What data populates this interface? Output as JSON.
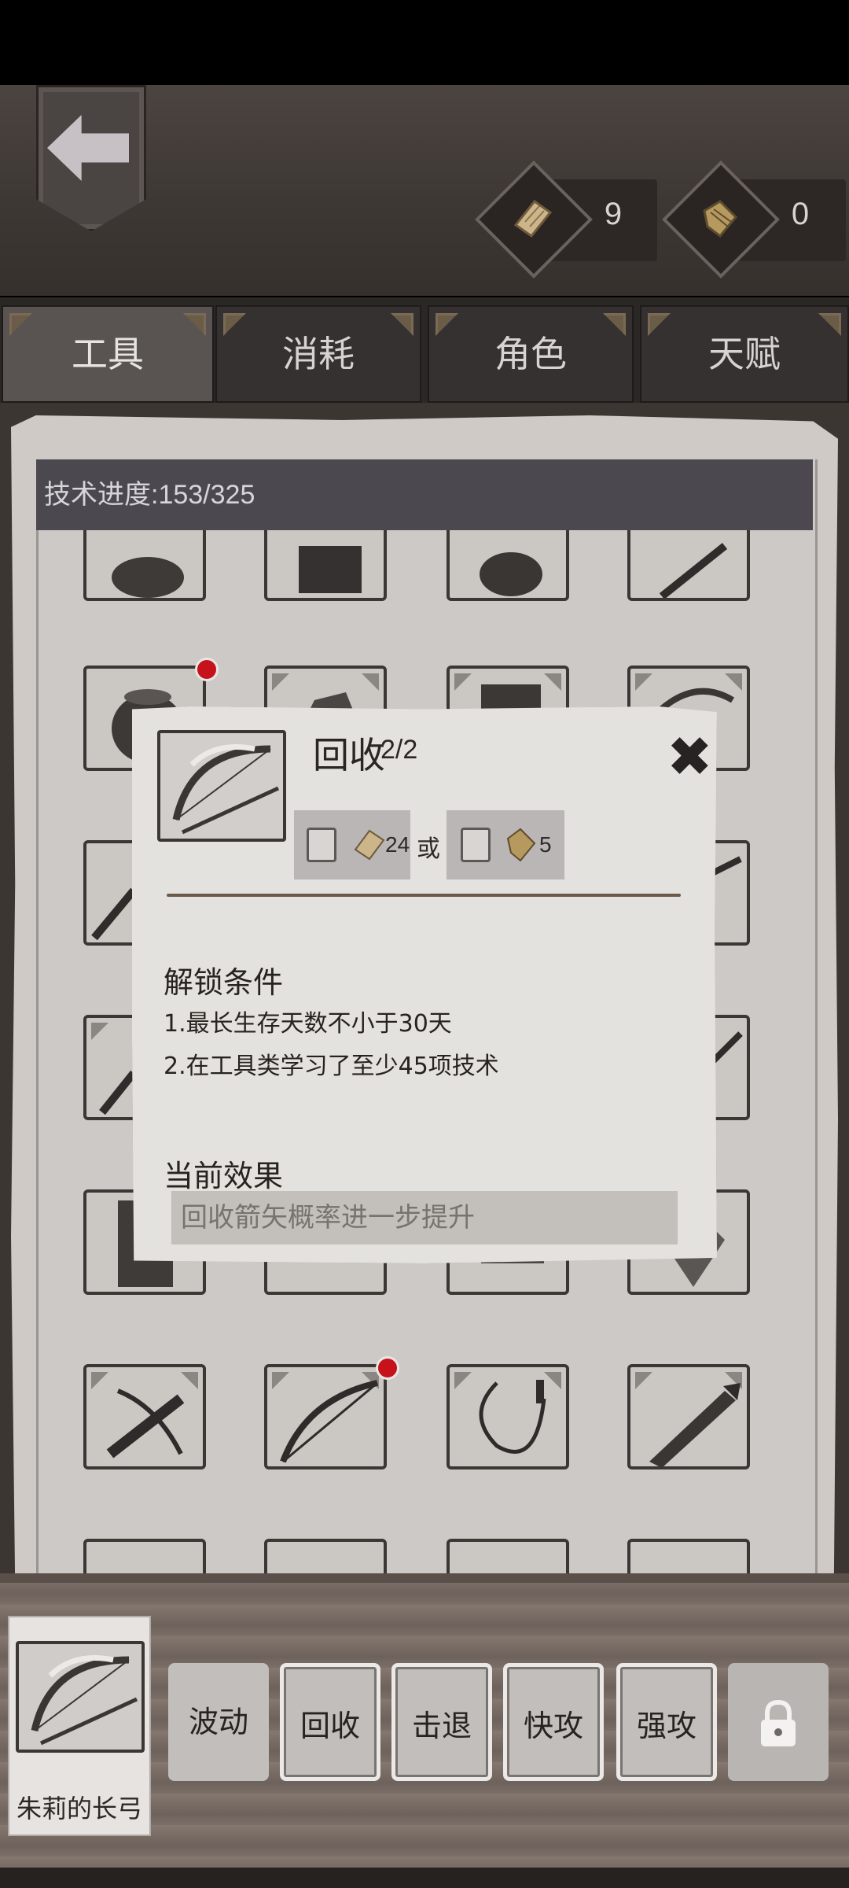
{
  "header": {
    "currency": [
      {
        "icon": "parchment-scroll-icon",
        "value": "9"
      },
      {
        "icon": "tech-book-icon",
        "value": "0"
      }
    ]
  },
  "tabs": [
    {
      "label": "工具",
      "active": true
    },
    {
      "label": "消耗",
      "active": false
    },
    {
      "label": "角色",
      "active": false
    },
    {
      "label": "天赋",
      "active": false
    }
  ],
  "tech": {
    "progress_label": "技术进度:153/325"
  },
  "dialog": {
    "title": "回收",
    "title_count": "2/2",
    "costs": [
      {
        "icon": "parchment-scroll-icon",
        "amount": "24"
      },
      {
        "icon": "tech-book-icon",
        "amount": "5"
      }
    ],
    "or_text": "或",
    "unlock_title": "解锁条件",
    "conditions": [
      "1.最长生存天数不小于30天",
      "2.在工具类学习了至少45项技术"
    ],
    "effect_title": "当前效果",
    "effect_text": "回收箭矢概率进一步提升"
  },
  "bottom": {
    "weapon_name": "朱莉的长弓",
    "skills": [
      "波动",
      "回收",
      "击退",
      "快攻",
      "强攻"
    ],
    "lock_icon": "padlock-icon"
  },
  "colors": {
    "notification": "#c6131b",
    "active_tab": "#595452",
    "progress_header": "#4b4850"
  }
}
